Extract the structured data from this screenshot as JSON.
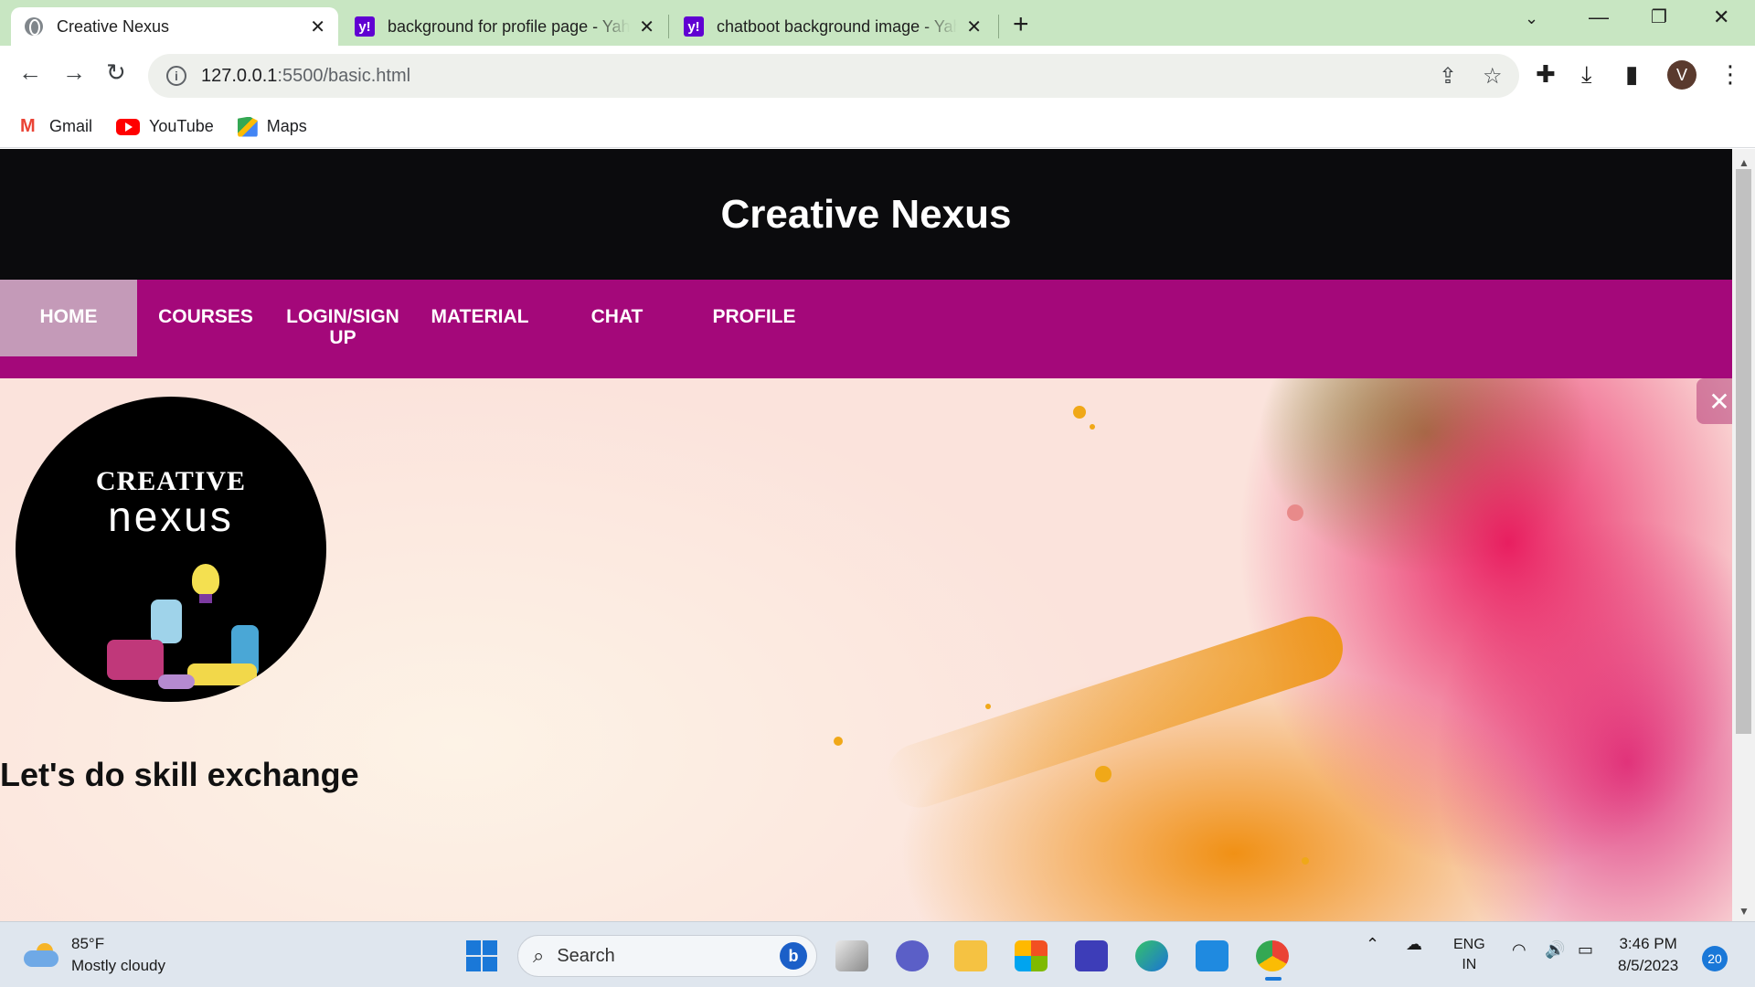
{
  "browser": {
    "tabs": [
      {
        "title": "Creative Nexus",
        "active": true,
        "favicon": "globe-icon"
      },
      {
        "title": "background for profile page - Yahoo",
        "active": false,
        "favicon": "yahoo-icon"
      },
      {
        "title": "chatboot background image - Yahoo",
        "active": false,
        "favicon": "yahoo-icon"
      }
    ],
    "new_tab_label": "+",
    "address": {
      "host": "127.0.0.1",
      "rest": ":5500/basic.html"
    },
    "profile_initial": "V",
    "bookmarks": [
      {
        "label": "Gmail",
        "icon": "gmail-icon"
      },
      {
        "label": "YouTube",
        "icon": "youtube-icon"
      },
      {
        "label": "Maps",
        "icon": "maps-icon"
      }
    ]
  },
  "page": {
    "site_title": "Creative Nexus",
    "nav": [
      {
        "label": "HOME",
        "active": true
      },
      {
        "label": "COURSES",
        "active": false
      },
      {
        "label": "LOGIN/SIGN UP",
        "active": false
      },
      {
        "label": "MATERIAL",
        "active": false
      },
      {
        "label": "CHAT",
        "active": false
      },
      {
        "label": "PROFILE",
        "active": false
      }
    ],
    "logo": {
      "line1": "CREATIVE",
      "line2": "nexus"
    },
    "tagline": "Let's do skill exchange",
    "colors": {
      "header_bg": "#0b0b0d",
      "nav_bg": "#a4087a",
      "nav_active_bg": "#c49ab8"
    }
  },
  "taskbar": {
    "weather": {
      "temp": "85°F",
      "condition": "Mostly cloudy"
    },
    "search_label": "Search",
    "language": {
      "line1": "ENG",
      "line2": "IN"
    },
    "clock": {
      "time": "3:46 PM",
      "date": "8/5/2023"
    },
    "notification_count": "20"
  }
}
